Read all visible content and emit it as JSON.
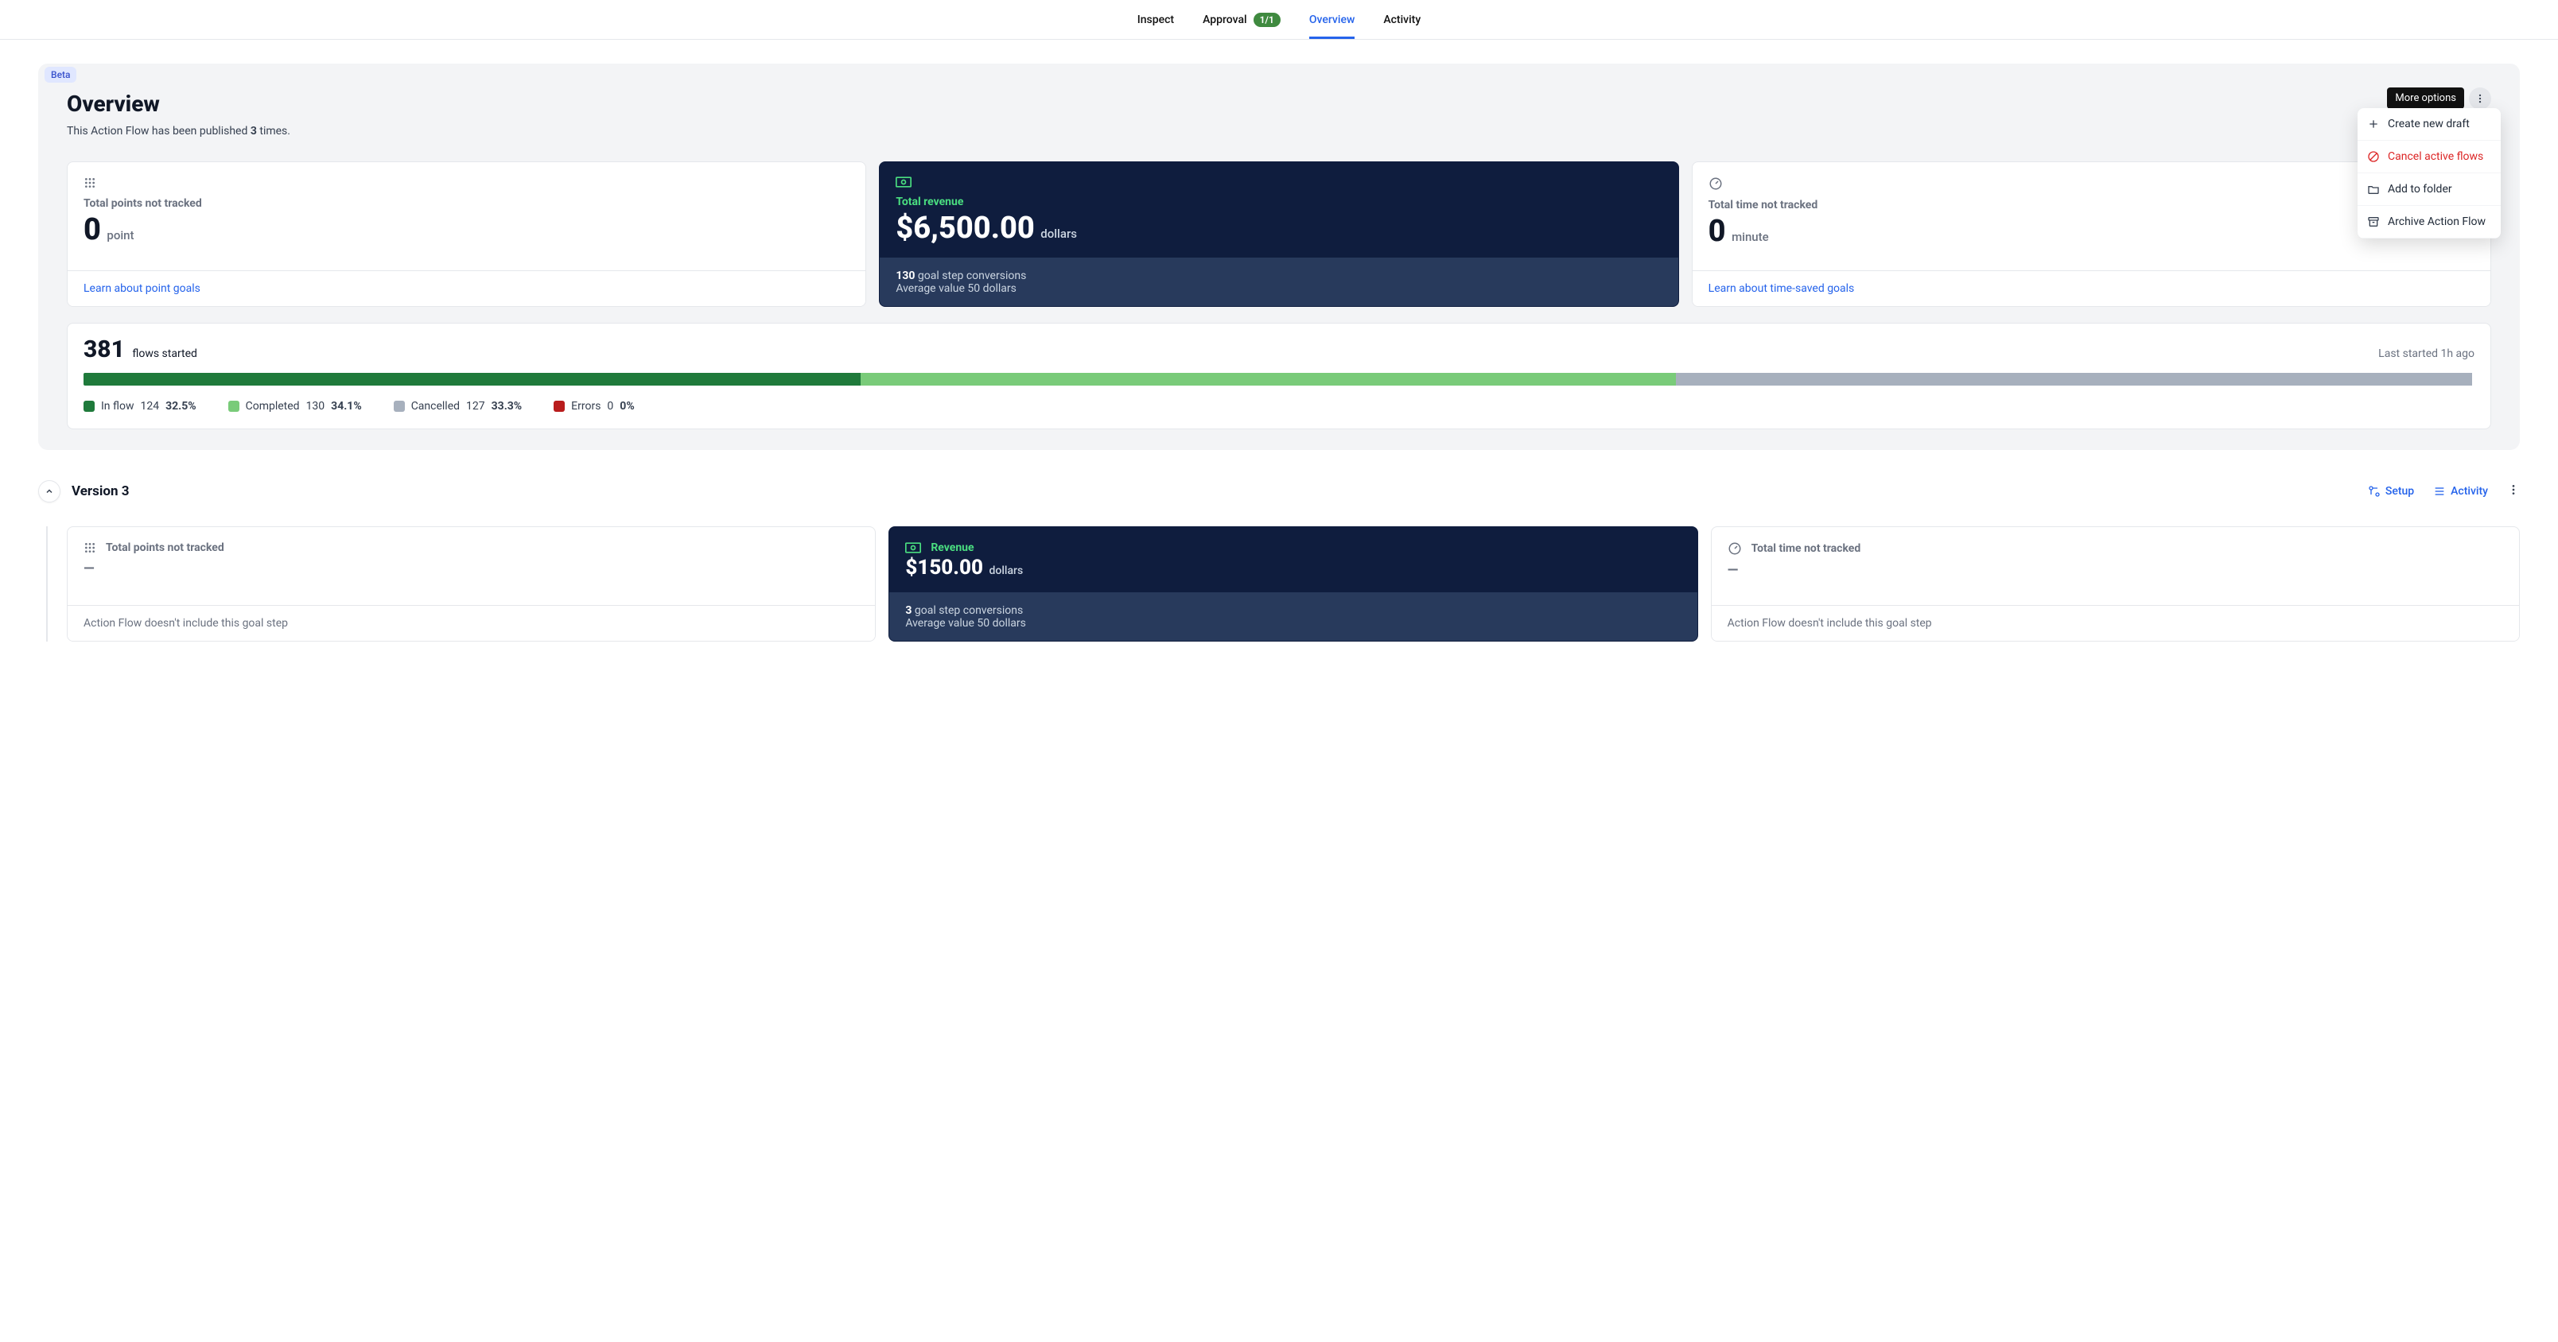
{
  "tabs": {
    "inspect": "Inspect",
    "approval": "Approval",
    "approval_badge": "1/1",
    "overview": "Overview",
    "activity": "Activity"
  },
  "overview": {
    "beta": "Beta",
    "title": "Overview",
    "sub_prefix": "This Action Flow has been published ",
    "sub_count": "3",
    "sub_suffix": " times.",
    "more_tooltip": "More options"
  },
  "menu": {
    "new_draft": "Create new draft",
    "cancel": "Cancel active flows",
    "add_folder": "Add to folder",
    "archive": "Archive Action Flow"
  },
  "cards": {
    "points": {
      "title": "Total points not tracked",
      "value": "0",
      "unit": "point",
      "foot": "Learn about point goals"
    },
    "revenue": {
      "title": "Total revenue",
      "value": "$6,500.00",
      "unit": "dollars",
      "foot_count": "130",
      "foot_label": "goal step conversions",
      "foot_avg": "Average value 50 dollars"
    },
    "time": {
      "title": "Total time not tracked",
      "value": "0",
      "unit": "minute",
      "foot": "Learn about time-saved goals"
    }
  },
  "flows": {
    "count": "381",
    "label": "flows started",
    "last": "Last started 1h ago",
    "inflow": {
      "label": "In flow",
      "n": "124",
      "pct": "32.5%"
    },
    "completed": {
      "label": "Completed",
      "n": "130",
      "pct": "34.1%"
    },
    "cancelled": {
      "label": "Cancelled",
      "n": "127",
      "pct": "33.3%"
    },
    "errors": {
      "label": "Errors",
      "n": "0",
      "pct": "0%"
    }
  },
  "version": {
    "title": "Version 3",
    "setup": "Setup",
    "activity": "Activity",
    "points": {
      "title": "Total points not tracked",
      "foot": "Action Flow doesn't include this goal step"
    },
    "revenue": {
      "title": "Revenue",
      "value": "$150.00",
      "unit": "dollars",
      "foot_count": "3",
      "foot_label": "goal step conversions",
      "foot_avg": "Average value 50 dollars"
    },
    "time": {
      "title": "Total time not tracked",
      "foot": "Action Flow doesn't include this goal step"
    }
  }
}
